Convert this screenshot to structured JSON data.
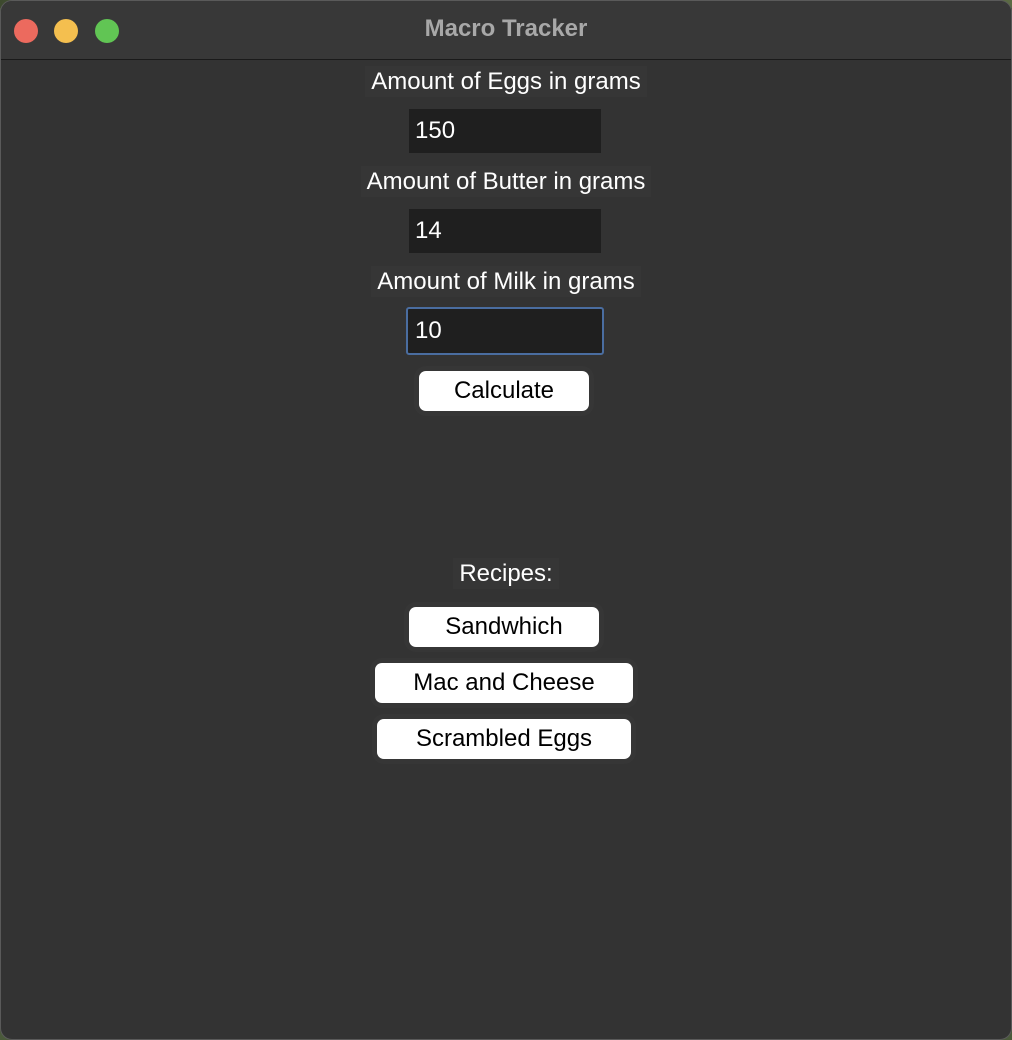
{
  "window": {
    "title": "Macro Tracker"
  },
  "form": {
    "eggs_label": "Amount of Eggs in grams",
    "eggs_value": "150",
    "butter_label": "Amount of Butter in grams",
    "butter_value": "14",
    "milk_label": "Amount of Milk in grams",
    "milk_value": "10",
    "calculate_label": "Calculate"
  },
  "recipes": {
    "heading": "Recipes:",
    "items": [
      {
        "label": "Sandwhich"
      },
      {
        "label": "Mac and Cheese"
      },
      {
        "label": "Scrambled Eggs"
      }
    ]
  },
  "colors": {
    "window_bg": "#333333",
    "titlebar_bg": "#383838",
    "entry_bg": "#1f1f1f",
    "focus_ring": "#4a6da0",
    "button_bg": "#ffffff",
    "close": "#ec6a5e",
    "minimize": "#f4bf4f",
    "zoom": "#61c554"
  }
}
